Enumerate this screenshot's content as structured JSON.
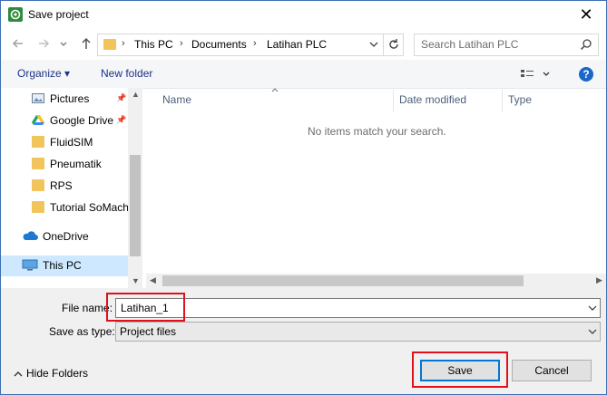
{
  "window": {
    "title": "Save project",
    "close_label": "✕"
  },
  "nav": {
    "back_icon": "arrow-left-icon",
    "forward_icon": "arrow-right-icon",
    "recent_icon": "chevron-down-icon",
    "up_icon": "arrow-up-icon",
    "breadcrumb": [
      "This PC",
      "Documents",
      "Latihan PLC"
    ],
    "search_placeholder": "Search Latihan PLC"
  },
  "command_bar": {
    "organize": "Organize ▾",
    "new_folder": "New folder"
  },
  "sidebar": {
    "items": [
      {
        "label": "Pictures",
        "icon": "pictures-icon",
        "pinned": true
      },
      {
        "label": "Google Drive",
        "icon": "google-drive-icon",
        "pinned": true
      },
      {
        "label": "FluidSIM",
        "icon": "folder-icon"
      },
      {
        "label": "Pneumatik",
        "icon": "folder-icon"
      },
      {
        "label": "RPS",
        "icon": "folder-icon"
      },
      {
        "label": "Tutorial SoMach",
        "icon": "folder-icon"
      },
      {
        "label": "OneDrive",
        "icon": "onedrive-icon"
      },
      {
        "label": "This PC",
        "icon": "pc-icon",
        "selected": true
      }
    ]
  },
  "file_list": {
    "columns": [
      "Name",
      "Date modified",
      "Type"
    ],
    "empty_message": "No items match your search."
  },
  "form": {
    "file_name_label": "File name:",
    "file_name_value": "Latihan_1",
    "save_as_type_label": "Save as type:",
    "save_as_type_value": "Project files"
  },
  "footer": {
    "hide_folders": "Hide Folders",
    "save": "Save",
    "cancel": "Cancel"
  },
  "colors": {
    "highlight": "#e0101c",
    "accent": "#0078d7",
    "link": "#1e3287"
  }
}
